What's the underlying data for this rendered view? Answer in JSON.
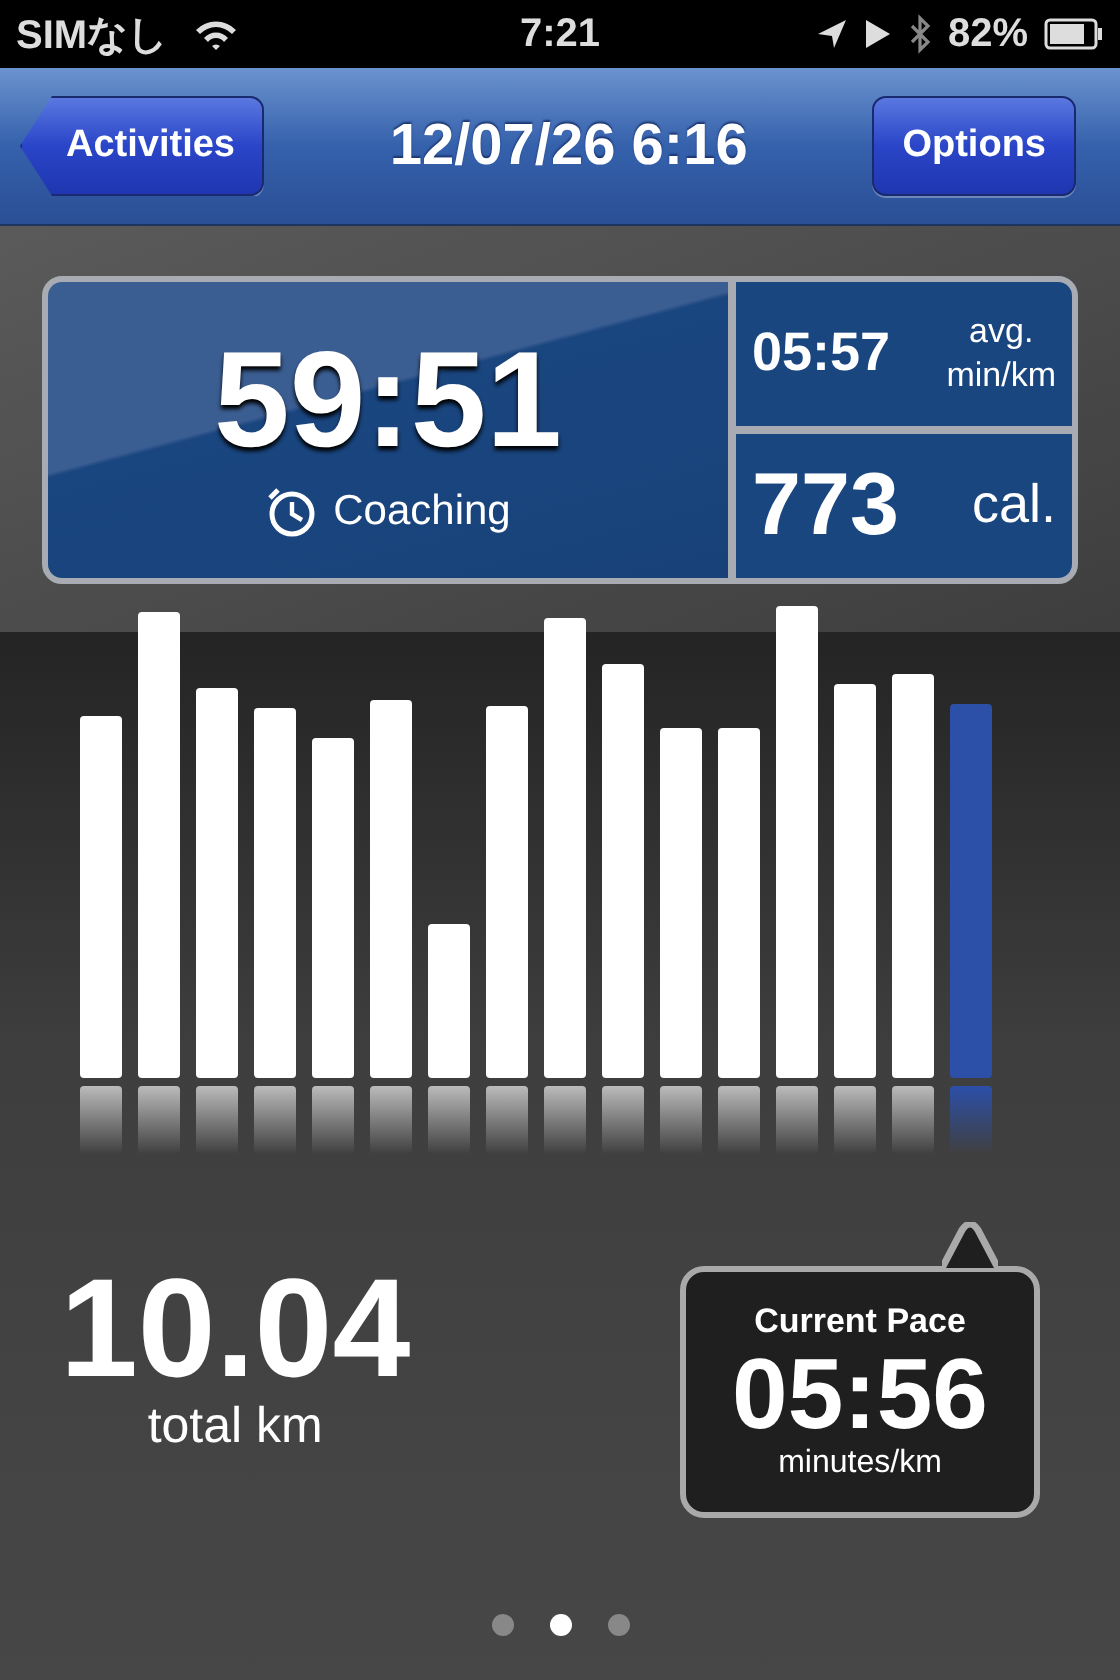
{
  "status_bar": {
    "carrier": "SIMなし",
    "time": "7:21",
    "battery": "82%"
  },
  "nav_bar": {
    "back_button": "Activities",
    "title": "12/07/26 6:16",
    "right_button": "Options"
  },
  "summary": {
    "duration": "59:51",
    "coaching": "Coaching",
    "avg_pace": "05:57",
    "avg_label_1": "avg.",
    "avg_label_2": "min/km",
    "calories": "773",
    "calories_unit": "cal."
  },
  "splits": [
    {
      "selected": false
    },
    {
      "selected": false
    },
    {
      "selected": false
    },
    {
      "selected": false
    },
    {
      "selected": false
    },
    {
      "selected": false
    },
    {
      "selected": false
    },
    {
      "selected": false
    },
    {
      "selected": false
    },
    {
      "selected": false
    },
    {
      "selected": false
    },
    {
      "selected": false
    },
    {
      "selected": false
    },
    {
      "selected": false
    },
    {
      "selected": false
    },
    {
      "selected": true
    }
  ],
  "distance": {
    "value": "10.04",
    "unit": "total km"
  },
  "current_pace": {
    "title": "Current Pace",
    "value": "05:56",
    "unit": "minutes/km"
  },
  "pages": [
    {
      "selected": false
    },
    {
      "selected": true
    },
    {
      "selected": false
    }
  ]
}
